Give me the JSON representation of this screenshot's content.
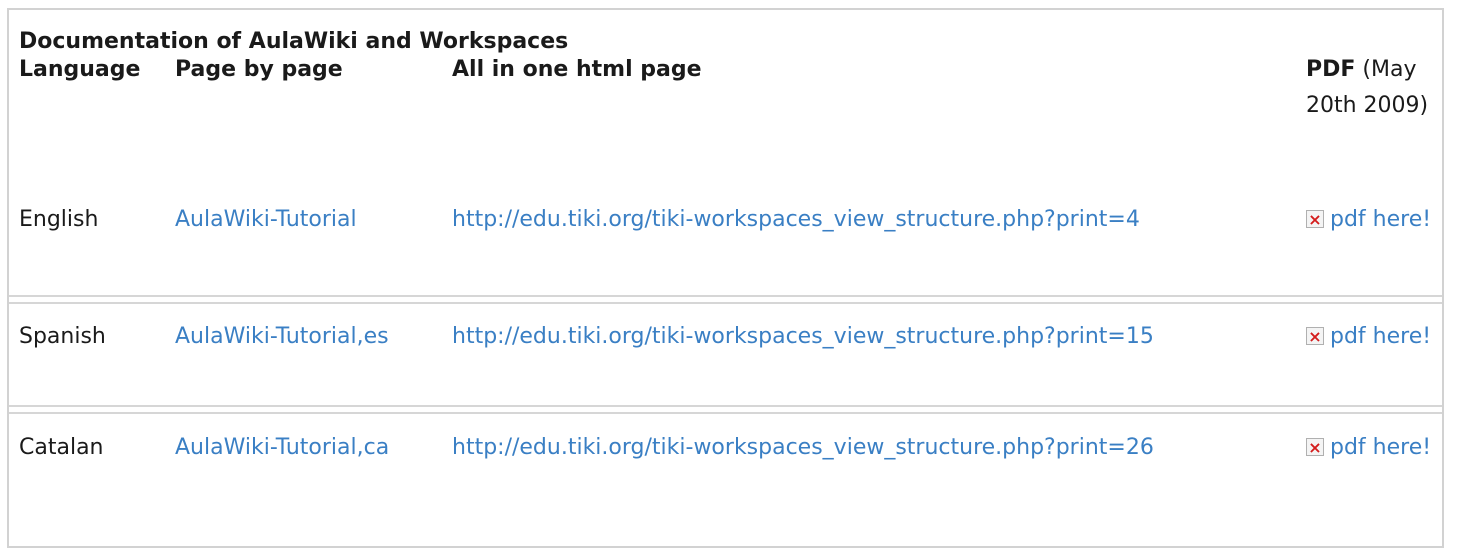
{
  "table": {
    "title": "Documentation of AulaWiki and Workspaces",
    "headers": {
      "language": "Language",
      "page_by_page": "Page by page",
      "all_in_one": "All in one html page",
      "pdf": "PDF",
      "pdf_date": "(May 20th 2009)"
    },
    "rows": [
      {
        "language": "English",
        "page_link": "AulaWiki-Tutorial",
        "html_link": "http://edu.tiki.org/tiki-workspaces_view_structure.php?print=4",
        "pdf_icon": "broken-image-icon",
        "pdf_link": "pdf here!"
      },
      {
        "language": "Spanish",
        "page_link": "AulaWiki-Tutorial,es",
        "html_link": "http://edu.tiki.org/tiki-workspaces_view_structure.php?print=15",
        "pdf_icon": "broken-image-icon",
        "pdf_link": "pdf here!"
      },
      {
        "language": "Catalan",
        "page_link": "AulaWiki-Tutorial,ca",
        "html_link": "http://edu.tiki.org/tiki-workspaces_view_structure.php?print=26",
        "pdf_icon": "broken-image-icon",
        "pdf_link": "pdf here!"
      }
    ]
  },
  "colors": {
    "link": "#3a7fc4",
    "text": "#1a1a1a",
    "border": "#d2d2d2",
    "icon_x": "#d41c1c"
  }
}
